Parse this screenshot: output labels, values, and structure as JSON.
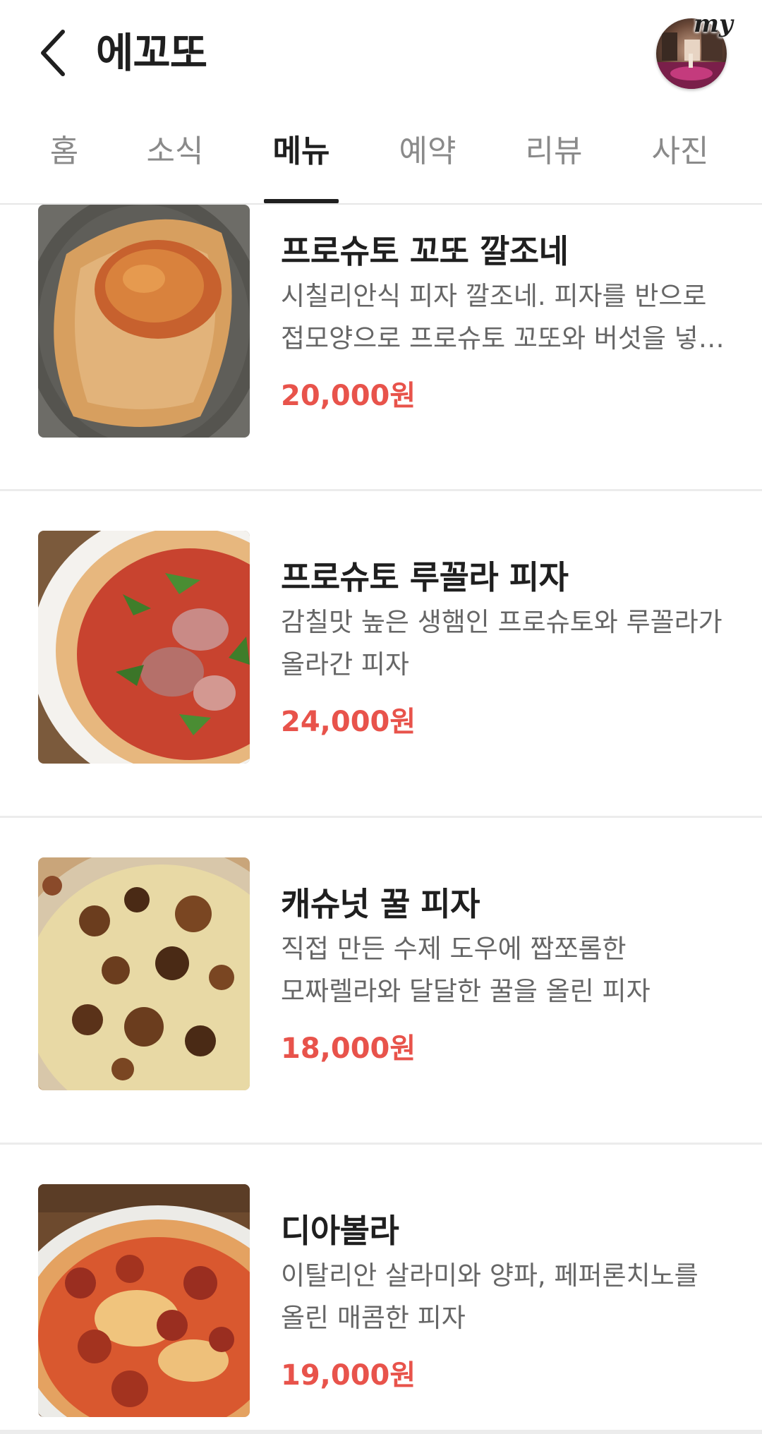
{
  "header": {
    "back_icon": "chevron-left-icon",
    "title": "에꼬또",
    "avatar_badge": "my"
  },
  "tabs": [
    {
      "label": "홈",
      "active": false
    },
    {
      "label": "소식",
      "active": false
    },
    {
      "label": "메뉴",
      "active": true
    },
    {
      "label": "예약",
      "active": false
    },
    {
      "label": "리뷰",
      "active": false
    },
    {
      "label": "사진",
      "active": false
    }
  ],
  "menu": {
    "items": [
      {
        "name": "프로슈토 꼬또 깔조네",
        "description": "시칠리안식 피자 깔조네. 피자를 반으로 접모양으로 프로슈토 꼬또와 버섯을 넣어 구운 피자",
        "price": "20,000원",
        "photo": "calzone"
      },
      {
        "name": "프로슈토 루꼴라 피자",
        "description": "감칠맛 높은 생햄인 프로슈토와 루꼴라가 올라간 피자",
        "price": "24,000원",
        "photo": "prosciutto-arugula-pizza"
      },
      {
        "name": "캐슈넛 꿀 피자",
        "description": "직접 만든 수제 도우에 짭쪼롬한 모짜렐라와 달달한 꿀을 올린 피자",
        "price": "18,000원",
        "photo": "cashew-honey-pizza"
      },
      {
        "name": "디아볼라",
        "description": "이탈리안 살라미와 양파, 페퍼론치노를 올린 매콤한 피자",
        "price": "19,000원",
        "photo": "diavola-pizza"
      }
    ]
  },
  "colors": {
    "price": "#e8534b",
    "active_tab": "#1f1f1f",
    "inactive_tab": "#8a8a8a",
    "description": "#666666",
    "divider": "#ececec"
  }
}
